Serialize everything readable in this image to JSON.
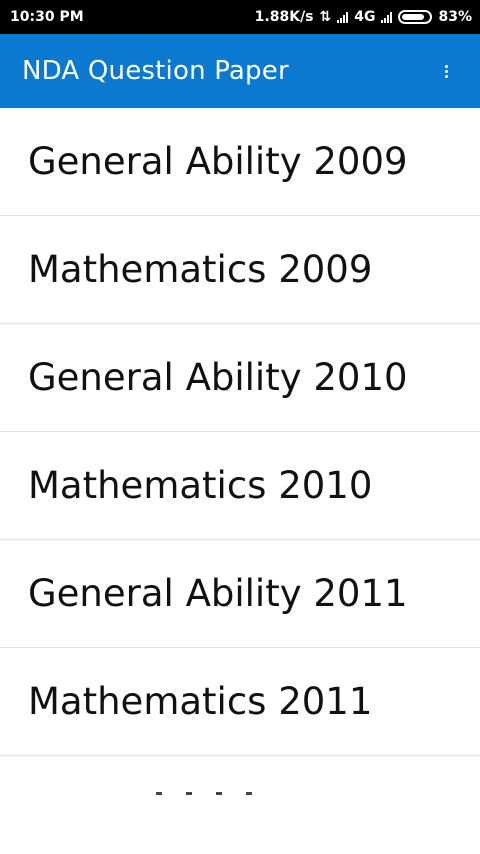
{
  "status_bar": {
    "time": "10:30 PM",
    "speed": "1.88K/s",
    "network": "4G",
    "battery": "83%"
  },
  "app_bar": {
    "title": "NDA Question Paper"
  },
  "list": {
    "items": [
      {
        "label": "General Ability 2009"
      },
      {
        "label": "Mathematics 2009"
      },
      {
        "label": "General Ability 2010"
      },
      {
        "label": "Mathematics 2010"
      },
      {
        "label": "General Ability 2011"
      },
      {
        "label": "Mathematics 2011"
      }
    ]
  },
  "colors": {
    "app_bar": "#0b79cf",
    "status_bar": "#000000",
    "divider": "#e3e3e3"
  },
  "icons": [
    "data-transfer-icon",
    "signal-icon",
    "battery-icon",
    "overflow-menu-icon"
  ]
}
